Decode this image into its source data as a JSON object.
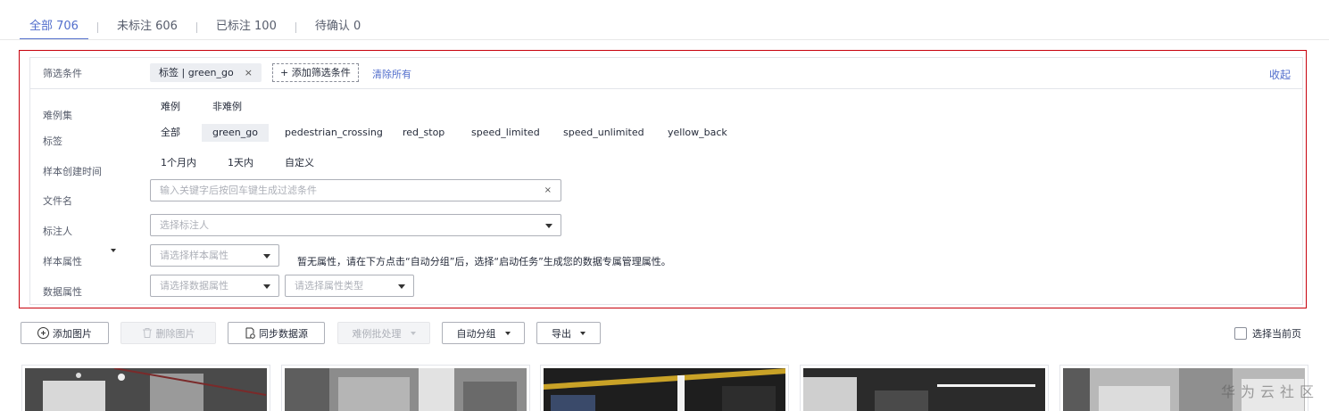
{
  "tabs": [
    {
      "label": "全部 706"
    },
    {
      "label": "未标注 606"
    },
    {
      "label": "已标注 100"
    },
    {
      "label": "待确认 0"
    }
  ],
  "filter": {
    "conditions_label": "筛选条件",
    "active_chip": "标签 | green_go",
    "chip_close": "×",
    "add_condition": "+ 添加筛选条件",
    "clear_all": "清除所有",
    "collapse": "收起",
    "hard_case": {
      "label": "难例集",
      "options": [
        "难例",
        "非难例"
      ]
    },
    "tag": {
      "label": "标签",
      "options": [
        "全部",
        "green_go",
        "pedestrian_crossing",
        "red_stop",
        "speed_limited",
        "speed_unlimited",
        "yellow_back"
      ],
      "selected": "green_go"
    },
    "created_time": {
      "label": "样本创建时间",
      "options": [
        "1个月内",
        "1天内",
        "自定义"
      ]
    },
    "filename": {
      "label": "文件名",
      "placeholder": "输入关键字后按回车键生成过滤条件",
      "clear": "×"
    },
    "annotator": {
      "label": "标注人",
      "placeholder": "选择标注人"
    },
    "sample_attr": {
      "label": "样本属性",
      "placeholder": "请选择样本属性",
      "hint": "暂无属性，请在下方点击“自动分组”后，选择“启动任务”生成您的数据专属管理属性。"
    },
    "data_attr": {
      "label": "数据属性",
      "placeholder": "请选择数据属性",
      "type_placeholder": "请选择属性类型"
    }
  },
  "toolbar": {
    "add_image": "添加图片",
    "delete_image": "删除图片",
    "sync_source": "同步数据源",
    "hard_batch": "难例批处理",
    "auto_group": "自动分组",
    "export": "导出",
    "select_page": "选择当前页"
  },
  "watermark": "华为云社区",
  "colors": {
    "accent": "#526ecc",
    "highlight_border": "#c7000b"
  }
}
